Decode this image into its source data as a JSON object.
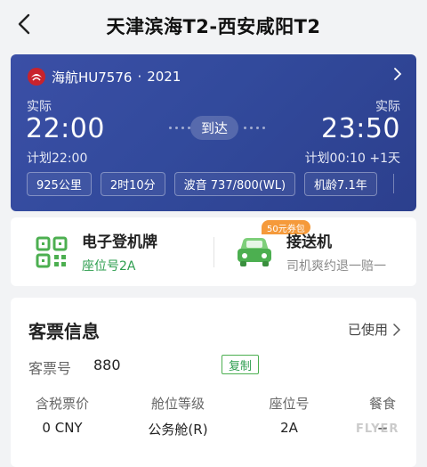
{
  "header": {
    "title": "天津滨海T2-西安咸阳T2"
  },
  "flight": {
    "airline": "海航HU7576",
    "year": "2021",
    "dep_label": "实际",
    "dep_time": "22:00",
    "dep_planned": "计划22:00",
    "status": "到达",
    "arr_label": "实际",
    "arr_time": "23:50",
    "arr_planned": "计划00:10 +1天",
    "tags": [
      "925公里",
      "2时10分",
      "波音 737/800(WL)",
      "机龄7.1年"
    ],
    "brand_color": "#c8232c"
  },
  "services": {
    "boarding_pass": {
      "title": "电子登机牌",
      "subtitle": "座位号2A"
    },
    "pickup": {
      "title": "接送机",
      "subtitle": "司机爽约退一赔一",
      "coupon": "50元券包"
    }
  },
  "ticket": {
    "title": "客票信息",
    "status": "已使用",
    "number_label": "客票号",
    "number": "880",
    "copy_label": "复制",
    "columns": [
      {
        "label": "含税票价",
        "value": "0 CNY"
      },
      {
        "label": "舱位等级",
        "value": "公务舱(R)"
      },
      {
        "label": "座位号",
        "value": "2A"
      },
      {
        "label": "餐食",
        "value": "--"
      }
    ]
  },
  "watermark": "FLYER"
}
